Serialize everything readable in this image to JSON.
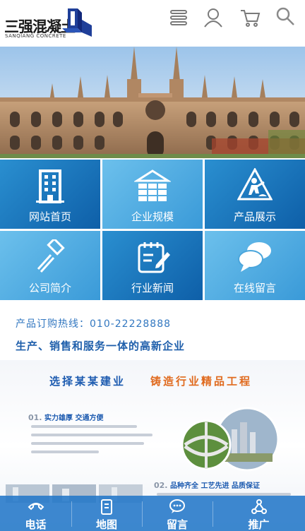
{
  "header": {
    "logo_text": "三强混凝土",
    "logo_sub": "SANQIANG CONCRETE",
    "icons": [
      "menu-icon",
      "user-icon",
      "cart-icon",
      "search-icon"
    ]
  },
  "tiles": [
    {
      "label": "网站首页",
      "icon": "building-icon"
    },
    {
      "label": "企业规模",
      "icon": "warehouse-icon"
    },
    {
      "label": "产品展示",
      "icon": "worker-icon"
    },
    {
      "label": "公司简介",
      "icon": "hammer-icon"
    },
    {
      "label": "行业新闻",
      "icon": "notepad-icon"
    },
    {
      "label": "在线留言",
      "icon": "chat-icon"
    }
  ],
  "hotline": {
    "phone_line": "产品订购热线：010-22228888",
    "tagline": "生产、销售和服务一体的高新企业"
  },
  "promo": {
    "slogan_left": "选择某某建业",
    "slogan_right": "铸造行业精品工程",
    "feature1_num": "01.",
    "feature1_title": "实力雄厚 交通方便",
    "feature2_num": "02.",
    "feature2_title": "品种齐全 工艺先进 品质保证"
  },
  "bottom_nav": [
    {
      "label": "电话",
      "icon": "phone-icon"
    },
    {
      "label": "地图",
      "icon": "map-icon"
    },
    {
      "label": "留言",
      "icon": "message-icon"
    },
    {
      "label": "推广",
      "icon": "share-icon"
    }
  ],
  "colors": {
    "tile_dark": "#0e5fa8",
    "tile_light": "#3a9ad8",
    "brand_blue": "#1d5bb0",
    "accent_orange": "#e06a1e",
    "nav_bg": "#2378c8"
  }
}
